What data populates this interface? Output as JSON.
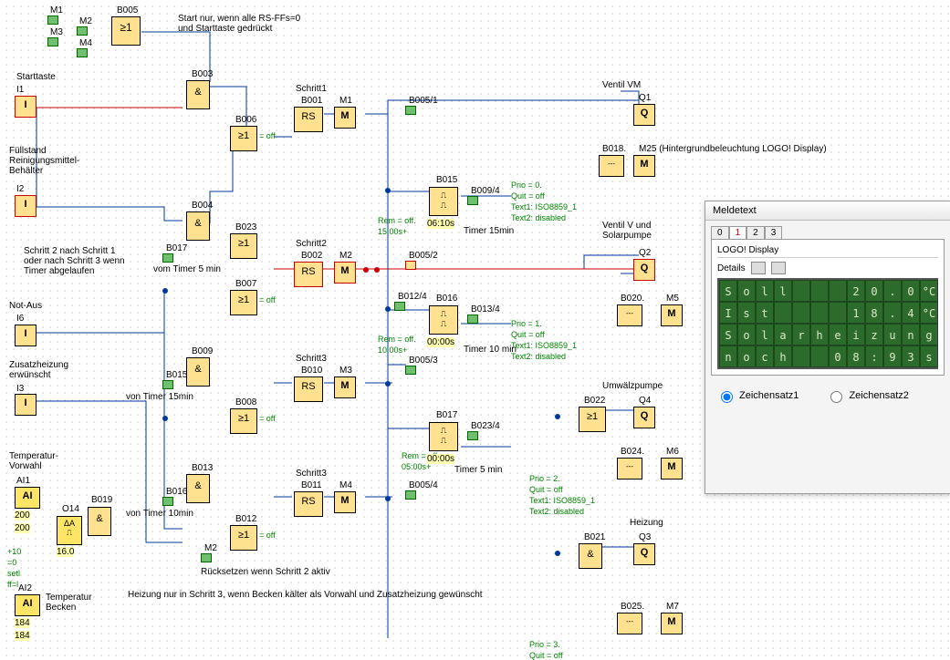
{
  "topLabels": {
    "m1": "M1",
    "m2": "M2",
    "m3": "M3",
    "m4": "M4",
    "b005": "B005",
    "startComment": "Start nur, wenn alle RS-FFs=0\nund Starttaste gedrückt"
  },
  "inputs": {
    "starttaste": {
      "title": "Starttaste",
      "id": "I1"
    },
    "fuell": {
      "title": "Füllstand\nReinigungsmittel-\nBehälter",
      "id": "I2"
    },
    "schritt2comment": "Schritt 2 nach Schritt 1\noder nach Schritt 3 wenn\nTimer abgelaufen",
    "notaus": {
      "title": "Not-Aus",
      "id": "I6"
    },
    "zusatz": {
      "title": "Zusatzheizung\nerwünscht",
      "id": "I3"
    },
    "tempvor": {
      "title": "Temperatur-\nVorwahl",
      "id": "AI1",
      "v1": "200",
      "v2": "200"
    },
    "ai2": {
      "id": "AI2",
      "t": "Temperatur\nBecken",
      "v1": "184",
      "v2": "184"
    },
    "o14": {
      "id": "O14",
      "a": "+10",
      "b": "=0",
      "c": "setl",
      "d": "ff=l",
      "val": "16.0"
    },
    "b019": "B019"
  },
  "col_and": {
    "b003": "B003",
    "b006": "B006",
    "b004": "B004",
    "b017": "B017",
    "b009": "B009",
    "b015": "B015",
    "b013": "B013",
    "b016": "B016",
    "t5": "vom Timer 5 min",
    "t15": "von Timer 15min",
    "t10": "von Timer 10min"
  },
  "or": {
    "b023": "B023",
    "b007": "B007",
    "b008": "B008",
    "b012": "B012",
    "off": "= off",
    "m2": "M2",
    "reset": "Rücksetzen wenn Schritt 2 aktiv"
  },
  "rs": {
    "s1": {
      "title": "Schritt1",
      "b": "B001",
      "m": "M1"
    },
    "s2": {
      "title": "Schritt2",
      "b": "B002",
      "m": "M2"
    },
    "s3a": {
      "title": "Schritt3",
      "b": "B010",
      "m": "M3"
    },
    "s3b": {
      "title": "Schritt3",
      "b": "B011",
      "m": "M4"
    }
  },
  "timers": {
    "t1": {
      "b": "B015",
      "split": "B009/4",
      "rem": "Rem = off.",
      "d": "15:00s+",
      "val": "06:10s",
      "name": "Timer 15min"
    },
    "t2": {
      "b": "B016",
      "split": "B013/4",
      "rem": "Rem = off.",
      "d": "10:00s+",
      "val": "00:00s",
      "name": "Timer 10 min",
      "b012": "B012/4"
    },
    "t3": {
      "b": "B017",
      "split": "B023/4",
      "rem": "Rem = off.",
      "d": "05:00s+",
      "val": "00:00s",
      "name": "Timer 5 min"
    },
    "b005_1": "B005/1",
    "b005_2": "B005/2",
    "b005_3": "B005/3",
    "b005_4": "B005/4"
  },
  "msg": {
    "p0": {
      "prio": "Prio = 0.",
      "quit": "Quit = off",
      "t1": "Text1: ISO8859_1",
      "t2": "Text2: disabled",
      "b": "B018.",
      "m": "M25 (Hintergrundbeleuchtung LOGO! Display)"
    },
    "p1": {
      "prio": "Prio = 1.",
      "quit": "Quit = off",
      "t1": "Text1: ISO8859_1",
      "t2": "Text2: disabled",
      "b": "B020.",
      "m": "M5"
    },
    "p2": {
      "prio": "Prio = 2.",
      "quit": "Quit = off",
      "t1": "Text1: ISO8859_1",
      "t2": "Text2: disabled",
      "b": "B024.",
      "m": "M6"
    },
    "p3": {
      "prio": "Prio = 3.",
      "quit": "Quit = off",
      "b": "B025.",
      "m": "M7"
    }
  },
  "outputs": {
    "q1": {
      "title": "Ventil VM",
      "q": "Q1"
    },
    "q2": {
      "title": "Ventil V und\nSolarpumpe",
      "q": "Q2"
    },
    "q4": {
      "title": "Umwälzpumpe",
      "q": "Q4",
      "b": "B022"
    },
    "q3": {
      "title": "Heizung",
      "q": "Q3",
      "b": "B021"
    }
  },
  "bottom": "Heizung nur in Schritt 3, wenn Becken kälter als Vorwahl und Zusatzheizung gewünscht",
  "panel": {
    "title": "Meldetext",
    "tabs": [
      "0",
      "1",
      "2",
      "3"
    ],
    "logo": "LOGO! Display",
    "details": "Details",
    "lcd": [
      [
        "S",
        "o",
        "l",
        "l",
        "",
        "",
        "",
        "2",
        "0",
        ".",
        "0",
        "°C"
      ],
      [
        "I",
        "s",
        "t",
        "",
        "",
        "",
        "",
        "1",
        "8",
        ".",
        "4",
        "°C"
      ],
      [
        "S",
        "o",
        "l",
        "a",
        "r",
        "h",
        "e",
        "i",
        "z",
        "u",
        "n",
        "g"
      ],
      [
        "n",
        "o",
        "c",
        "h",
        "",
        "",
        "0",
        "8",
        ":",
        "9",
        "3",
        "s"
      ]
    ],
    "r1": "Zeichensatz1",
    "r2": "Zeichensatz2"
  }
}
